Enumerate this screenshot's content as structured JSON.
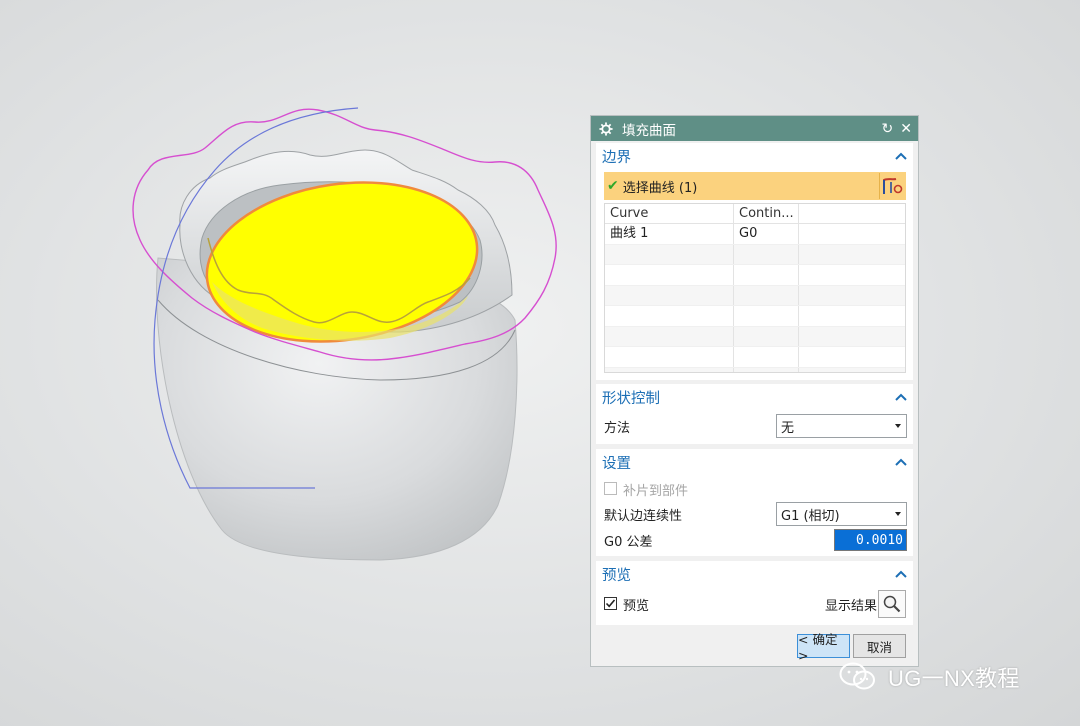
{
  "dialog": {
    "title": "填充曲面",
    "reset_icon": "reset-icon",
    "close_icon": "close-icon"
  },
  "boundary": {
    "header": "边界",
    "select_label": "选择曲线 (1)",
    "table": {
      "columns": [
        "Curve",
        "Contin..."
      ],
      "rows": [
        [
          "曲线 1",
          "G0"
        ]
      ]
    }
  },
  "shape_control": {
    "header": "形状控制",
    "method_label": "方法",
    "method_value": "无"
  },
  "settings": {
    "header": "设置",
    "patch_label": "补片到部件",
    "patch_checked": false,
    "continuity_label": "默认边连续性",
    "continuity_value": "G1 (相切)",
    "tolerance_label": "G0 公差",
    "tolerance_value": "0.0010"
  },
  "preview": {
    "header": "预览",
    "preview_label": "预览",
    "preview_checked": true,
    "show_result_label": "显示结果"
  },
  "buttons": {
    "ok": "< 确定 >",
    "cancel": "取消"
  },
  "watermark": {
    "text": "UG一NX教程"
  },
  "colors": {
    "title_bar": "#5f8f86",
    "section_header": "#1d6fb5",
    "selection_highlight": "#fbd27e",
    "fill_surface": "#ffff00",
    "curve_highlight": "#f08a3c",
    "input_selected": "#0a6fd6"
  }
}
